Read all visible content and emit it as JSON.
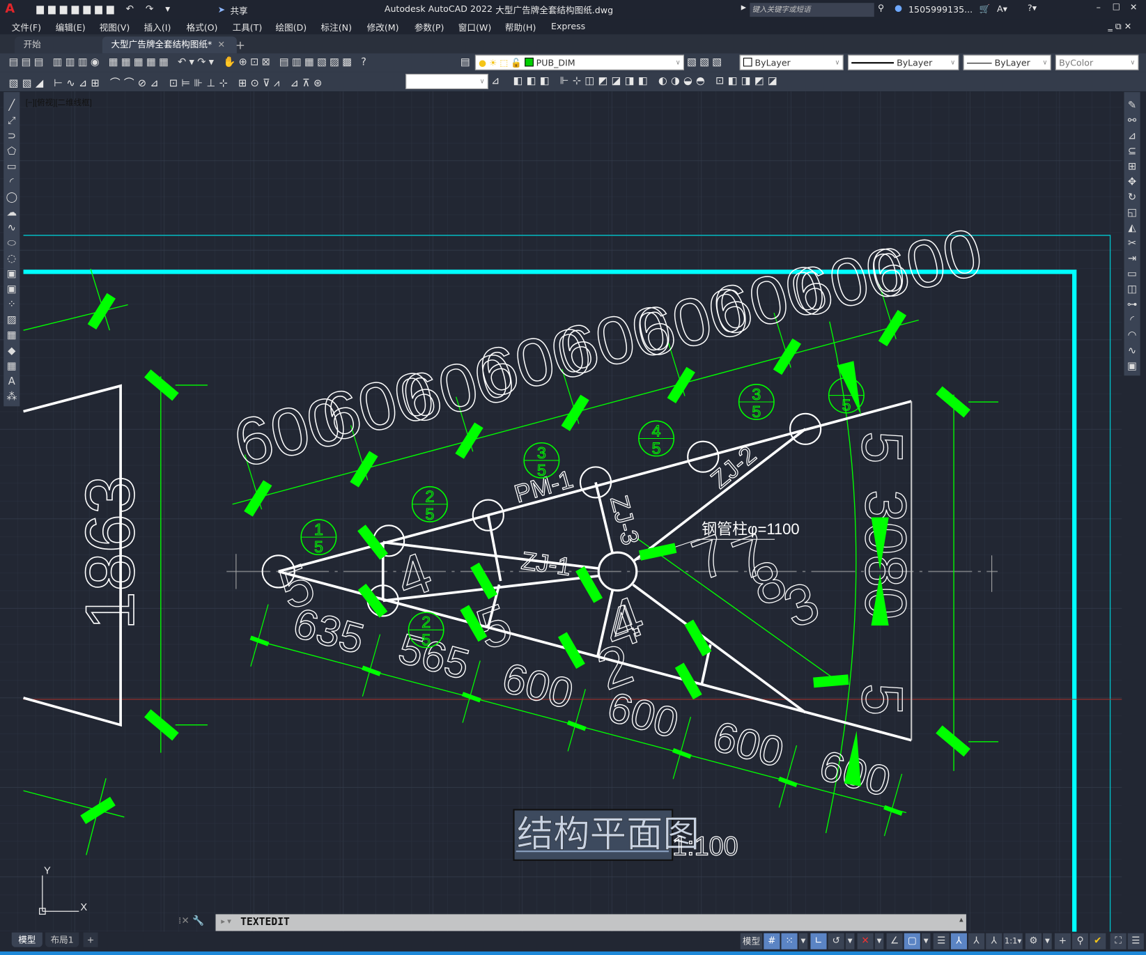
{
  "app": {
    "title": "Autodesk AutoCAD 2022",
    "filename": "大型广告牌全套结构图纸.dwg",
    "logo": "A",
    "share_label": "共享",
    "search_placeholder": "键入关键字或短语",
    "user": "1505999135...",
    "accent": "#00ffff"
  },
  "menu": [
    "文件(F)",
    "编辑(E)",
    "视图(V)",
    "插入(I)",
    "格式(O)",
    "工具(T)",
    "绘图(D)",
    "标注(N)",
    "修改(M)",
    "参数(P)",
    "窗口(W)",
    "帮助(H)",
    "Express"
  ],
  "tabs": [
    {
      "label": "开始",
      "active": false
    },
    {
      "label": "大型广告牌全套结构图纸*",
      "active": true
    }
  ],
  "toolbar": {
    "layer": "PUB_DIM",
    "color": "ByLayer",
    "linetype": "ByLayer",
    "lineweight": "ByLayer",
    "plotstyle": "ByColor",
    "textstyle": ""
  },
  "viewport_label": "[−][俯视][二维线框]",
  "drawing": {
    "top_dims": [
      "600",
      "600",
      "600",
      "600",
      "600",
      "600",
      "600",
      "600",
      "600"
    ],
    "left_dim": "1863",
    "bottom_dims": [
      "635",
      "565",
      "600",
      "600",
      "600",
      "600"
    ],
    "right_dims": [
      "5",
      "3080",
      "5"
    ],
    "members": [
      "PM-1",
      "ZJ-1",
      "ZJ-2",
      "ZJ-3"
    ],
    "column_note": "钢管柱φ=1100",
    "balloons": [
      {
        "top": "1",
        "bottom": "5"
      },
      {
        "top": "2",
        "bottom": "5"
      },
      {
        "top": "3",
        "bottom": "5"
      },
      {
        "top": "4",
        "bottom": "5"
      },
      {
        "top": "3",
        "bottom": "5"
      },
      {
        "top": "2",
        "bottom": "5"
      },
      {
        "top": "",
        "bottom": "5"
      }
    ],
    "misc_numbers": [
      "4",
      "4",
      "7",
      "7",
      "5",
      "5",
      "2",
      "4",
      "8",
      "3",
      "3"
    ],
    "title": "结构平面图",
    "scale": "1:100",
    "ucs_x": "X",
    "ucs_y": "Y",
    "colors": {
      "dim": "#00ff00",
      "object": "#ffffff",
      "border": "#00ffff",
      "axis": "#c0302a"
    }
  },
  "command": {
    "text": "TEXTEDIT"
  },
  "layout_tabs": [
    "模型",
    "布局1",
    "+"
  ],
  "status": {
    "model": "模型",
    "scale": "1:1"
  }
}
